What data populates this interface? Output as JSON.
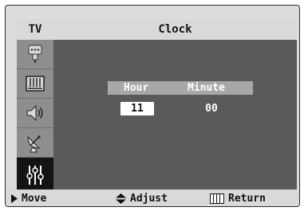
{
  "header": {
    "source": "TV",
    "title": "Clock"
  },
  "sidebar": {
    "items": [
      {
        "icon": "input-icon",
        "active": false
      },
      {
        "icon": "picture-icon",
        "active": false
      },
      {
        "icon": "sound-icon",
        "active": false
      },
      {
        "icon": "channel-icon",
        "active": false
      },
      {
        "icon": "setup-icon",
        "active": true
      }
    ]
  },
  "clock": {
    "hour_label": "Hour",
    "minute_label": "Minute",
    "hour_value": "11",
    "minute_value": "00"
  },
  "footer": {
    "move": "Move",
    "adjust": "Adjust",
    "return": "Return"
  },
  "colors": {
    "content_bg": "#5a5a5a",
    "sidebar_bg": "#8e8e8e",
    "active_item_bg": "#141414",
    "bar_bg": "#d9d9d9"
  }
}
